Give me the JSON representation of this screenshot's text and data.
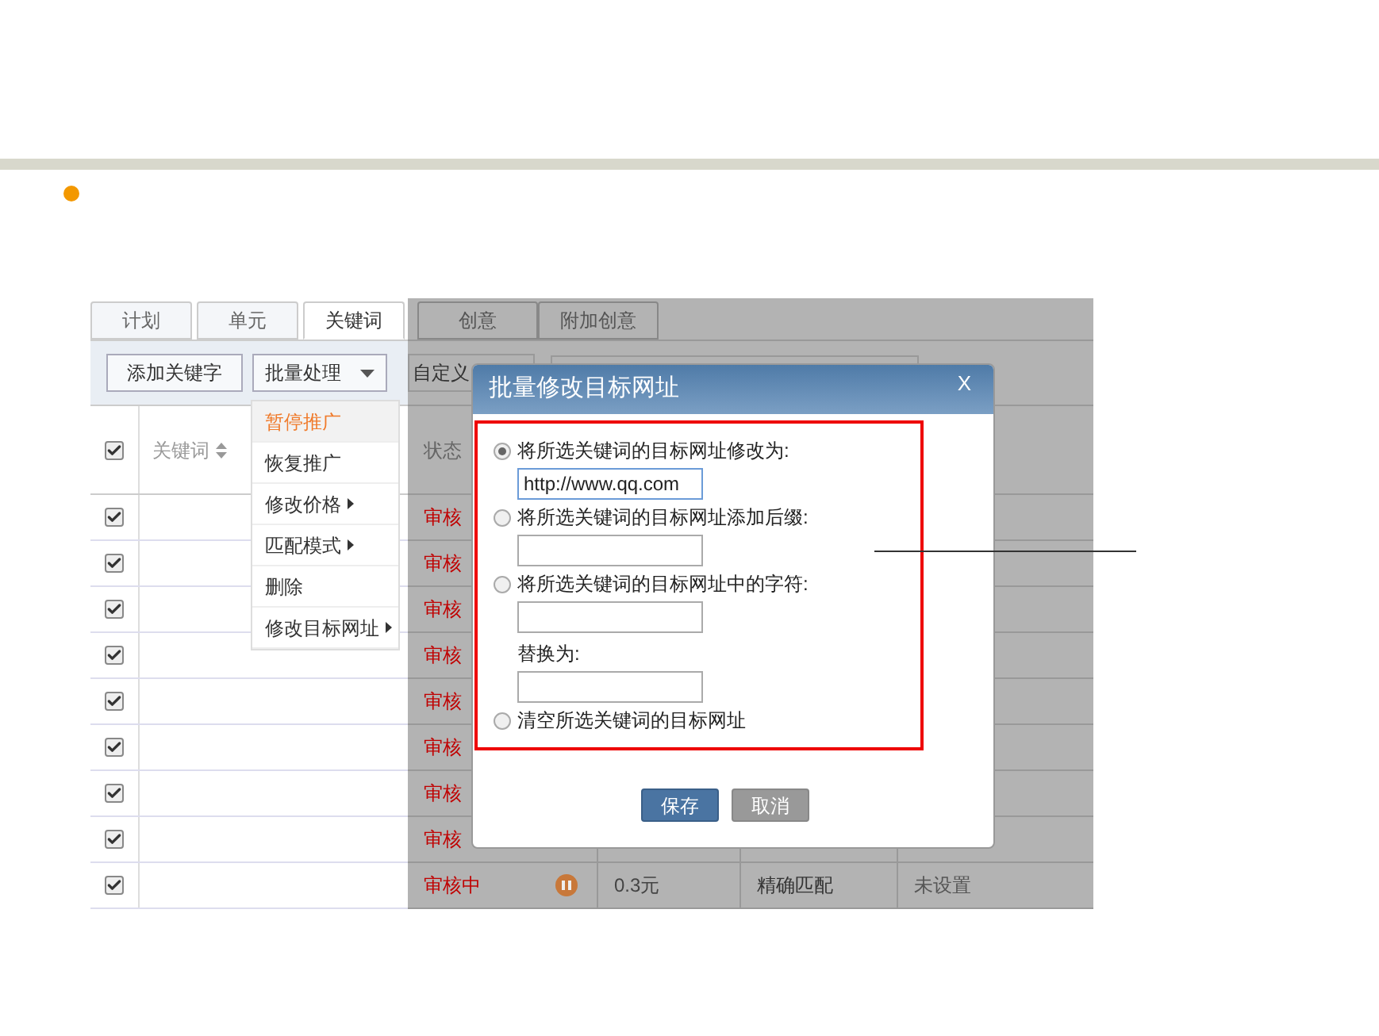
{
  "tabs": [
    {
      "label": "计划",
      "selected": false
    },
    {
      "label": "单元",
      "selected": false
    },
    {
      "label": "关键词",
      "selected": true
    },
    {
      "label": "创意",
      "selected": false
    },
    {
      "label": "附加创意",
      "selected": false
    }
  ],
  "toolbar": {
    "add_button": "添加关键字",
    "batch_button": "批量处理",
    "custom_button": "自定义"
  },
  "batch_menu": [
    {
      "label": "暂停推广",
      "highlighted": true,
      "submenu": false
    },
    {
      "label": "恢复推广",
      "highlighted": false,
      "submenu": false
    },
    {
      "label": "修改价格",
      "highlighted": false,
      "submenu": true
    },
    {
      "label": "匹配模式",
      "highlighted": false,
      "submenu": true
    },
    {
      "label": "删除",
      "highlighted": false,
      "submenu": false
    },
    {
      "label": "修改目标网址",
      "highlighted": false,
      "submenu": true
    }
  ],
  "table": {
    "header_checked": true,
    "columns": [
      "关键词",
      "状态"
    ],
    "rows": [
      {
        "checked": true,
        "status": "审核"
      },
      {
        "checked": true,
        "status": "审核"
      },
      {
        "checked": true,
        "status": "审核"
      },
      {
        "checked": true,
        "status": "审核"
      },
      {
        "checked": true,
        "status": "审核"
      },
      {
        "checked": true,
        "status": "审核"
      },
      {
        "checked": true,
        "status": "审核"
      },
      {
        "checked": true,
        "status": "审核"
      },
      {
        "checked": true,
        "status": "审核中",
        "paused": true,
        "price": "0.3元",
        "match": "精确匹配",
        "url": "未设置"
      }
    ]
  },
  "dialog": {
    "title": "批量修改目标网址",
    "close": "X",
    "options": [
      {
        "label": "将所选关键词的目标网址修改为:",
        "selected": true,
        "items": [
          {
            "kind": "input",
            "focused": true,
            "value": "http://www.qq.com"
          }
        ]
      },
      {
        "label": "将所选关键词的目标网址添加后缀:",
        "selected": false,
        "items": [
          {
            "kind": "input",
            "focused": false
          }
        ]
      },
      {
        "label": "将所选关键词的目标网址中的字符:",
        "selected": false,
        "items": [
          {
            "kind": "input",
            "focused": false
          },
          {
            "kind": "label",
            "text": "替换为:"
          },
          {
            "kind": "input",
            "focused": false
          }
        ]
      },
      {
        "label": "清空所选关键词的目标网址",
        "selected": false
      }
    ],
    "buttons": [
      {
        "label": "保存",
        "kind": "primary"
      },
      {
        "label": "取消",
        "kind": "secondary"
      }
    ]
  }
}
